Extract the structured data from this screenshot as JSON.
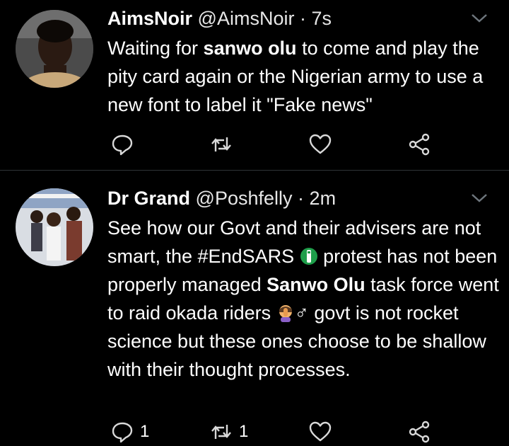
{
  "tweets": [
    {
      "display_name": "AimsNoir",
      "handle": "@AimsNoir",
      "separator": "·",
      "time": "7s",
      "body": [
        {
          "text": "Waiting for ",
          "bold": false
        },
        {
          "text": "sanwo olu",
          "bold": true
        },
        {
          "text": " to come and play the pity card again or the Nigerian army to use a new font to label it \"Fake news\"",
          "bold": false
        }
      ],
      "actions": {
        "reply_count": "",
        "retweet_count": "",
        "like_count": ""
      }
    },
    {
      "display_name": "Dr Grand",
      "handle": "@Poshfelly",
      "separator": "·",
      "time": "2m",
      "body": [
        {
          "text": "See how our Govt and their advisers are not smart, the #EndSARS",
          "bold": false
        },
        {
          "text": " protest has not been properly managed ",
          "bold": false
        },
        {
          "text": "Sanwo Olu",
          "bold": true
        },
        {
          "text": " task force went to raid okada riders ",
          "bold": false
        },
        {
          "text": "♂",
          "bold": false
        },
        {
          "text": " govt is not rocket science but these ones choose to be shallow with their thought processes.",
          "bold": false
        }
      ],
      "actions": {
        "reply_count": "1",
        "retweet_count": "1",
        "like_count": ""
      }
    }
  ],
  "icons": {
    "reply": "reply-icon",
    "retweet": "retweet-icon",
    "like": "heart-icon",
    "share": "share-icon",
    "caret": "chevron-down-icon",
    "endsars_emoji": "nigeria-flag-fist-emoji",
    "facepalm_emoji": "facepalm-emoji"
  },
  "colors": {
    "background": "#000000",
    "text": "#ffffff",
    "divider": "#2f3336",
    "icon": "#d9d9d9"
  }
}
